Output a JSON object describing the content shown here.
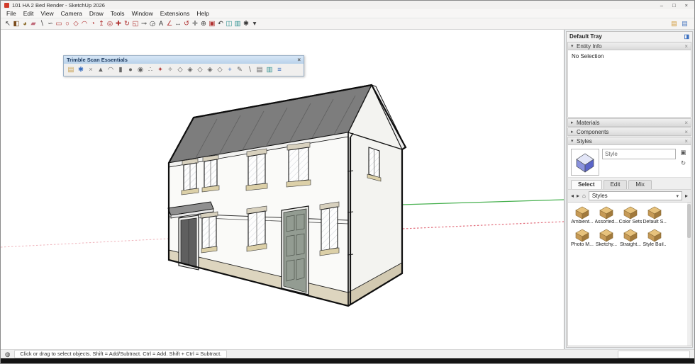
{
  "window": {
    "title": "101 HA 2 Bed Render - SketchUp 2026",
    "minimize": "–",
    "maximize": "□",
    "close": "×"
  },
  "menubar": {
    "items": [
      "File",
      "Edit",
      "View",
      "Camera",
      "Draw",
      "Tools",
      "Window",
      "Extensions",
      "Help"
    ]
  },
  "toolbar": {
    "icons": [
      {
        "name": "select-tool-icon",
        "glyph": "↖",
        "color": "#3a3a3a"
      },
      {
        "name": "make-component-icon",
        "glyph": "◧",
        "color": "#7a4a1a"
      },
      {
        "name": "paint-bucket-icon",
        "glyph": "◕",
        "color": "#8a6a2a"
      },
      {
        "name": "eraser-icon",
        "glyph": "▰",
        "color": "#c06a7a"
      },
      {
        "name": "line-tool-icon",
        "glyph": "∖",
        "color": "#3a3a3a"
      },
      {
        "name": "freehand-tool-icon",
        "glyph": "∽",
        "color": "#3a3a3a"
      },
      {
        "name": "rectangle-tool-icon",
        "glyph": "▭",
        "color": "#b03030"
      },
      {
        "name": "circle-tool-icon",
        "glyph": "○",
        "color": "#b03030"
      },
      {
        "name": "polygon-tool-icon",
        "glyph": "◇",
        "color": "#b03030"
      },
      {
        "name": "arc-tool-icon",
        "glyph": "◠",
        "color": "#b03030"
      },
      {
        "name": "pie-tool-icon",
        "glyph": "◔",
        "color": "#b03030"
      },
      {
        "name": "push-pull-tool-icon",
        "glyph": "↥",
        "color": "#b03030"
      },
      {
        "name": "offset-tool-icon",
        "glyph": "◎",
        "color": "#b03030"
      },
      {
        "name": "move-tool-icon",
        "glyph": "✚",
        "color": "#b03030"
      },
      {
        "name": "rotate-tool-icon",
        "glyph": "↻",
        "color": "#b03030"
      },
      {
        "name": "scale-tool-icon",
        "glyph": "◱",
        "color": "#b03030"
      },
      {
        "name": "tape-measure-icon",
        "glyph": "⊸",
        "color": "#3a3a3a"
      },
      {
        "name": "protractor-icon",
        "glyph": "◶",
        "color": "#3a3a3a"
      },
      {
        "name": "text-tool-icon",
        "glyph": "A",
        "color": "#3a3a3a"
      },
      {
        "name": "axes-tool-icon",
        "glyph": "∠",
        "color": "#b03030"
      },
      {
        "name": "dimension-tool-icon",
        "glyph": "↔",
        "color": "#3a3a3a"
      },
      {
        "name": "orbit-tool-icon",
        "glyph": "↺",
        "color": "#b03030"
      },
      {
        "name": "pan-tool-icon",
        "glyph": "✛",
        "color": "#3a3a3a"
      },
      {
        "name": "zoom-tool-icon",
        "glyph": "⊕",
        "color": "#3a3a3a"
      },
      {
        "name": "zoom-extents-icon",
        "glyph": "▣",
        "color": "#b03030"
      },
      {
        "name": "previous-view-icon",
        "glyph": "↶",
        "color": "#3a3a3a"
      },
      {
        "name": "section-plane-icon",
        "glyph": "◫",
        "color": "#2a8f8f"
      },
      {
        "name": "x-ray-icon",
        "glyph": "▥",
        "color": "#2a8f8f"
      },
      {
        "name": "settings-gear-icon",
        "glyph": "✱",
        "color": "#3a3a3a"
      },
      {
        "name": "gear-dropdown-icon",
        "glyph": "▾",
        "color": "#3a3a3a"
      }
    ],
    "right_icons": [
      {
        "name": "page-edit-icon",
        "glyph": "▤",
        "color": "#d29a3a"
      },
      {
        "name": "page-view-icon",
        "glyph": "▤",
        "color": "#4a78c0"
      }
    ]
  },
  "floating_toolbar": {
    "title": "Trimble Scan Essentials",
    "close": "×",
    "icons": [
      {
        "name": "open-folder-icon",
        "glyph": "▤",
        "color": "#c8a050"
      },
      {
        "name": "scan-settings-gear-icon",
        "glyph": "✱",
        "color": "#3a6fc0"
      },
      {
        "name": "scan-close-tool-icon",
        "glyph": "×",
        "color": "#888888"
      },
      {
        "name": "cone-icon",
        "glyph": "▲",
        "color": "#666666"
      },
      {
        "name": "dome-icon",
        "glyph": "◠",
        "color": "#666666"
      },
      {
        "name": "cylinder-icon",
        "glyph": "▮",
        "color": "#666666"
      },
      {
        "name": "sphere-icon",
        "glyph": "●",
        "color": "#666666"
      },
      {
        "name": "droplet-icon",
        "glyph": "◉",
        "color": "#666666"
      },
      {
        "name": "scan-points-icon",
        "glyph": "∴",
        "color": "#666666"
      },
      {
        "name": "magic-wand-icon",
        "glyph": "✦",
        "color": "#b04040"
      },
      {
        "name": "clean-wand-icon",
        "glyph": "✧",
        "color": "#666666"
      },
      {
        "name": "polygon-a-icon",
        "glyph": "◇",
        "color": "#666666"
      },
      {
        "name": "polygon-b-icon",
        "glyph": "◈",
        "color": "#666666"
      },
      {
        "name": "polygon-c-icon",
        "glyph": "◇",
        "color": "#666666"
      },
      {
        "name": "polygon-d-icon",
        "glyph": "◈",
        "color": "#666666"
      },
      {
        "name": "polygon-e-icon",
        "glyph": "◇",
        "color": "#666666"
      },
      {
        "name": "add-point-icon",
        "glyph": "+",
        "color": "#3a6fc0"
      },
      {
        "name": "pencil-icon",
        "glyph": "✎",
        "color": "#666666"
      },
      {
        "name": "slash-icon",
        "glyph": "∖",
        "color": "#666666"
      },
      {
        "name": "layers-a-icon",
        "glyph": "▤",
        "color": "#666666"
      },
      {
        "name": "layers-b-icon",
        "glyph": "▥",
        "color": "#2a8f8f"
      },
      {
        "name": "layers-stack-icon",
        "glyph": "≡",
        "color": "#4a78c0"
      }
    ]
  },
  "viewport": {
    "axis_colors": {
      "red": "#e2707e",
      "green": "#46b04e"
    }
  },
  "tray": {
    "title": "Default Tray",
    "options_icon": "◨",
    "entity_info": {
      "label": "Entity Info",
      "chevron": "▾",
      "close": "×",
      "content": "No Selection"
    },
    "materials": {
      "label": "Materials",
      "chevron": "▸",
      "close": "×"
    },
    "components": {
      "label": "Components",
      "chevron": "▸",
      "close": "×"
    },
    "styles": {
      "label": "Styles",
      "chevron": "▾",
      "close": "×",
      "name_value": "Style",
      "new_icon": "▣",
      "refresh_icon": "↻",
      "tabs": [
        "Select",
        "Edit",
        "Mix"
      ],
      "back_icon": "◂",
      "forward_icon": "▸",
      "home_icon": "⌂",
      "dropdown_value": "Styles",
      "dd_arrow": "▾",
      "detail_icon": "▸",
      "items": [
        "Ambient...",
        "Assorted...",
        "Color Sets",
        "Default S...",
        "Photo M...",
        "Sketchy...",
        "Straight...",
        "Style Buil..."
      ]
    }
  },
  "statusbar": {
    "status_icon": "◍",
    "hint": "Click or drag to select objects. Shift = Add/Subtract. Ctrl = Add. Shift + Ctrl = Subtract.",
    "measurements_value": ""
  }
}
